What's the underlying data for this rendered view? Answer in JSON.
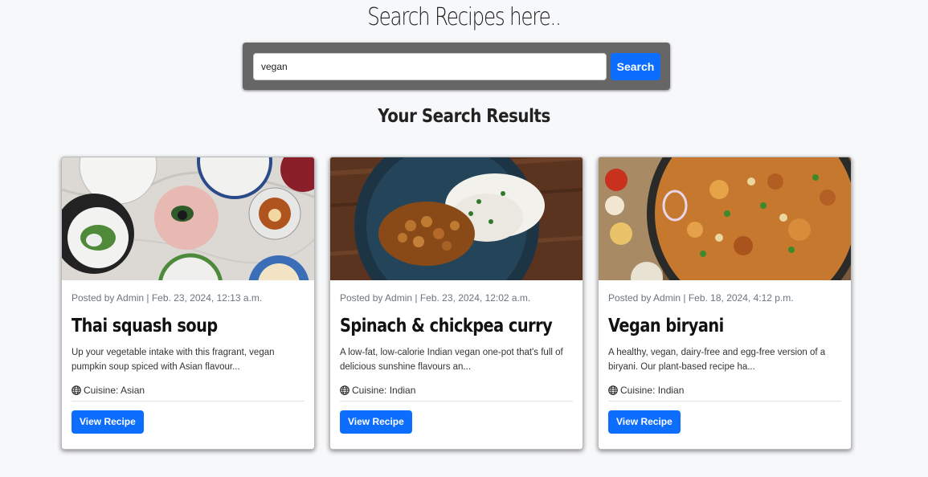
{
  "header": {
    "title": "Search Recipes here.."
  },
  "search": {
    "value": "vegan",
    "button_label": "Search"
  },
  "results": {
    "heading": "Your Search Results",
    "cards": [
      {
        "meta": "Posted by Admin | Feb. 23, 2024, 12:13 a.m.",
        "title": "Thai squash soup",
        "description": "Up your vegetable intake with this fragrant, vegan pumpkin soup spiced with Asian flavour...",
        "cuisine": "Cuisine: Asian",
        "button_label": "View Recipe"
      },
      {
        "meta": "Posted by Admin | Feb. 23, 2024, 12:02 a.m.",
        "title": "Spinach & chickpea curry",
        "description": "A low-fat, low-calorie Indian vegan one-pot that's full of delicious sunshine flavours an...",
        "cuisine": "Cuisine: Indian",
        "button_label": "View Recipe"
      },
      {
        "meta": "Posted by Admin | Feb. 18, 2024, 4:12 p.m.",
        "title": "Vegan biryani",
        "description": "A healthy, vegan, dairy-free and egg-free version of a biryani. Our plant-based recipe ha...",
        "cuisine": "Cuisine: Indian",
        "button_label": "View Recipe"
      }
    ]
  },
  "colors": {
    "accent": "#0d6efd",
    "search_panel": "#666666",
    "background": "#f7f8fa"
  },
  "icons": {
    "cuisine": "globe-icon"
  }
}
